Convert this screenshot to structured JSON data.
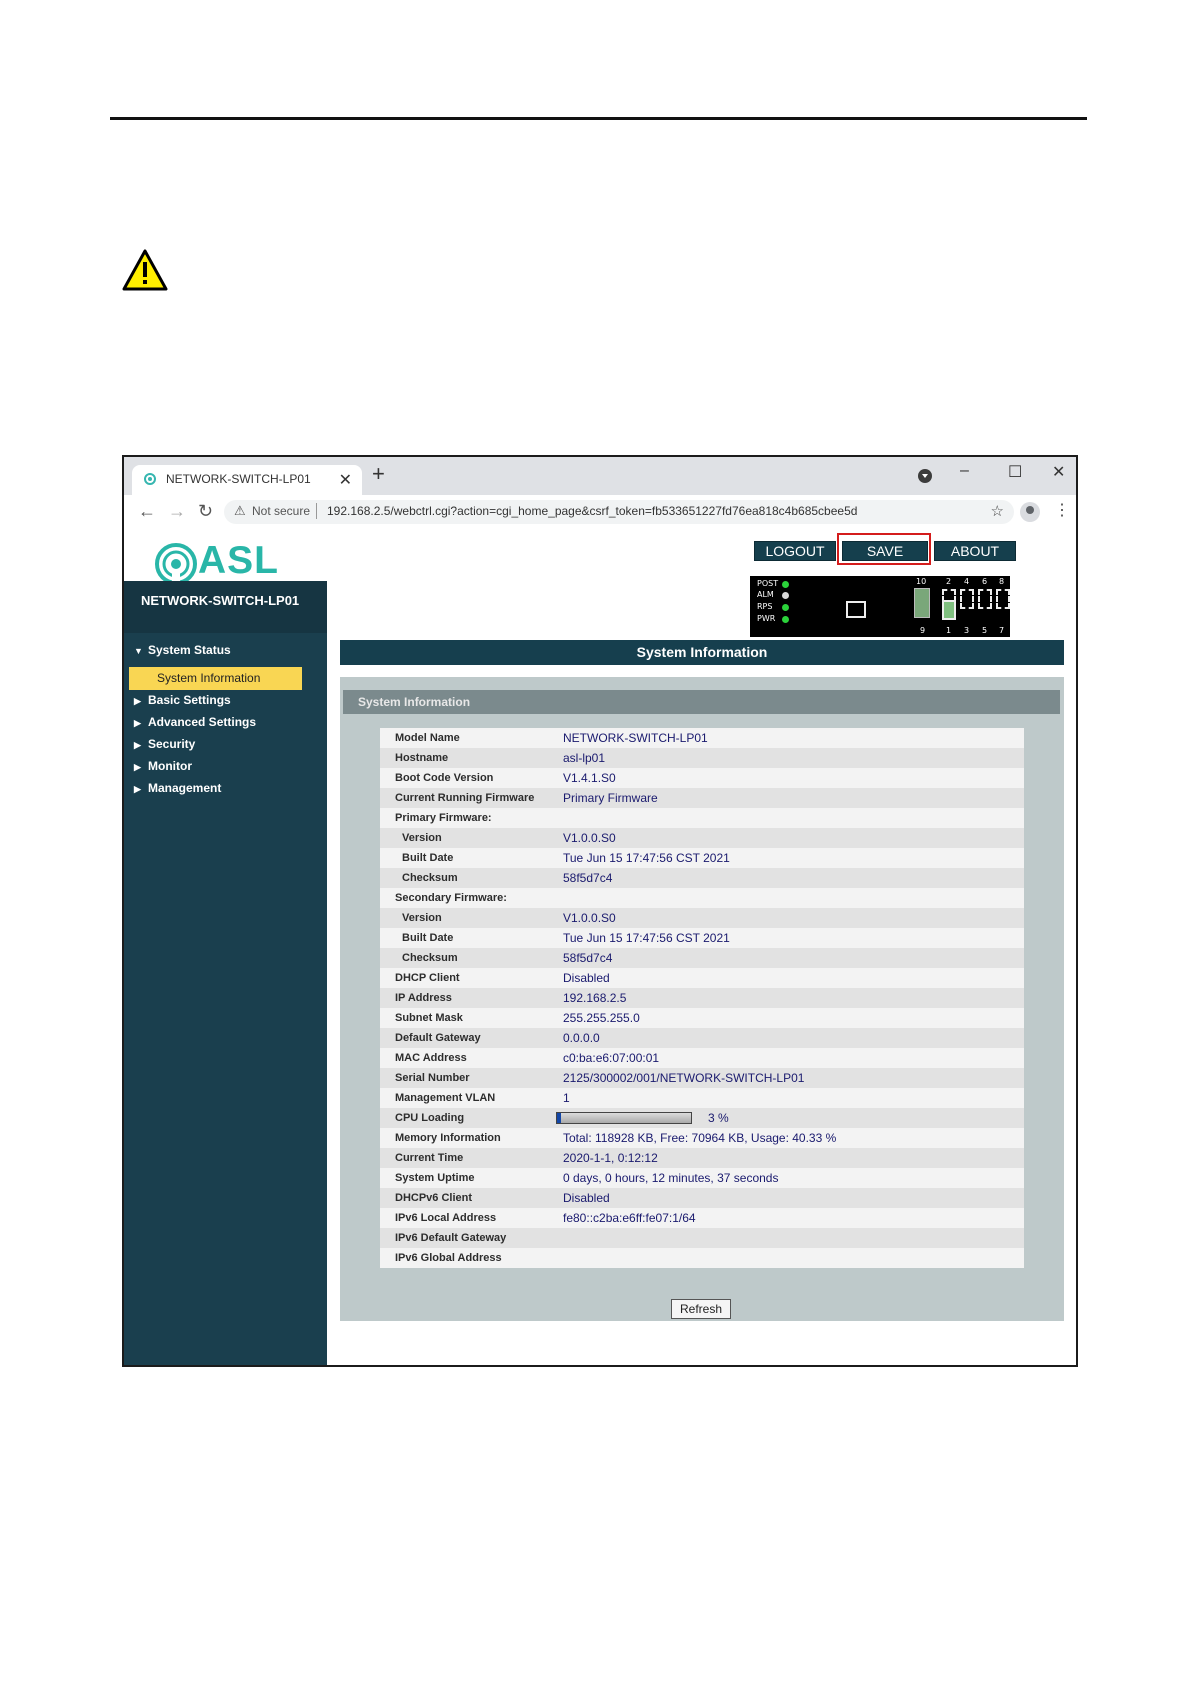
{
  "browser": {
    "tab_title": "NETWORK-SWITCH-LP01",
    "security_label": "Not secure",
    "url": "192.168.2.5/webctrl.cgi?action=cgi_home_page&csrf_token=fb533651227fd76ea818c4b685cbee5d"
  },
  "logo": {
    "text": "ASL"
  },
  "header": {
    "logout_label": "LOGOUT",
    "save_label": "SAVE",
    "about_label": "ABOUT"
  },
  "panel": {
    "post": "POST",
    "alm": "ALM",
    "rps": "RPS",
    "pwr": "PWR",
    "sfp_top": "10",
    "sfp_bottom": "9",
    "ports_top": [
      "2",
      "4",
      "6",
      "8"
    ],
    "ports_bottom": [
      "1",
      "3",
      "5",
      "7"
    ]
  },
  "sidebar": {
    "device_name": "NETWORK-SWITCH-LP01",
    "items": [
      {
        "label": "System Status",
        "expanded": true
      },
      {
        "label": "Basic Settings"
      },
      {
        "label": "Advanced Settings"
      },
      {
        "label": "Security"
      },
      {
        "label": "Monitor"
      },
      {
        "label": "Management"
      }
    ],
    "active_subitem": "System Information"
  },
  "main": {
    "title": "System Information",
    "section_title": "System Information",
    "rows": [
      {
        "label": "Model Name",
        "value": "NETWORK-SWITCH-LP01"
      },
      {
        "label": "Hostname",
        "value": "asl-lp01"
      },
      {
        "label": "Boot Code Version",
        "value": "V1.4.1.S0"
      },
      {
        "label": "Current Running Firmware",
        "value": "Primary Firmware"
      },
      {
        "label": "Primary Firmware:",
        "value": ""
      },
      {
        "label": "Version",
        "value": "V1.0.0.S0"
      },
      {
        "label": "Built Date",
        "value": "Tue Jun 15 17:47:56 CST 2021"
      },
      {
        "label": "Checksum",
        "value": "58f5d7c4"
      },
      {
        "label": "Secondary Firmware:",
        "value": ""
      },
      {
        "label": "Version",
        "value": "V1.0.0.S0"
      },
      {
        "label": "Built Date",
        "value": "Tue Jun 15 17:47:56 CST 2021"
      },
      {
        "label": "Checksum",
        "value": "58f5d7c4"
      },
      {
        "label": "DHCP Client",
        "value": "Disabled"
      },
      {
        "label": "IP Address",
        "value": "192.168.2.5"
      },
      {
        "label": "Subnet Mask",
        "value": "255.255.255.0"
      },
      {
        "label": "Default Gateway",
        "value": "0.0.0.0"
      },
      {
        "label": "MAC Address",
        "value": "c0:ba:e6:07:00:01"
      },
      {
        "label": "Serial Number",
        "value": "2125/300002/001/NETWORK-SWITCH-LP01"
      },
      {
        "label": "Management VLAN",
        "value": "1"
      },
      {
        "label": "CPU Loading",
        "value": ""
      },
      {
        "label": "Memory Information",
        "value": "Total: 118928 KB,  Free: 70964 KB,  Usage: 40.33 %"
      },
      {
        "label": "Current Time",
        "value": "2020-1-1, 0:12:12"
      },
      {
        "label": "System Uptime",
        "value": " 0 days, 0 hours, 12 minutes, 37 seconds"
      },
      {
        "label": "DHCPv6 Client",
        "value": " Disabled"
      },
      {
        "label": "IPv6 Local Address",
        "value": "fe80::c2ba:e6ff:fe07:1/64"
      },
      {
        "label": "IPv6 Default Gateway",
        "value": ""
      },
      {
        "label": "IPv6 Global Address",
        "value": ""
      }
    ],
    "cpu_loading_percent": 3,
    "cpu_loading_text": "3 %",
    "refresh_label": "Refresh"
  }
}
